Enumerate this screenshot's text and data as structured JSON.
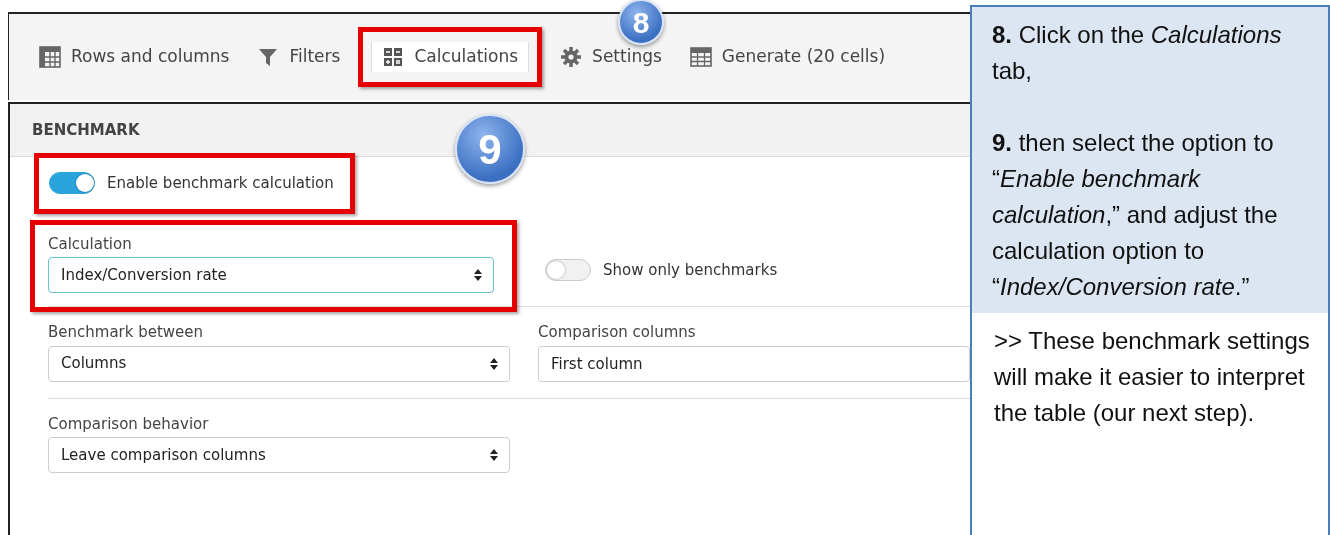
{
  "tabs": [
    {
      "label": "Rows and columns",
      "selected": false
    },
    {
      "label": "Filters",
      "selected": false
    },
    {
      "label": "Calculations",
      "selected": true
    },
    {
      "label": "Settings",
      "selected": false
    },
    {
      "label": "Generate (20 cells)",
      "selected": false
    }
  ],
  "highlighted_tab": {
    "selected": true
  },
  "step_badges": [
    {
      "number": "8"
    },
    {
      "number": "9"
    }
  ],
  "section": {
    "title": "BENCHMARK",
    "toggle": {
      "label": "Enable benchmark calculation",
      "on": true,
      "highlighted": true
    },
    "rows": [
      [
        {
          "kind": "select",
          "label": "Calculation",
          "value": "Index/Conversion rate",
          "highlighted": true,
          "focused": true
        },
        {
          "kind": "toggle",
          "label": "Show only benchmarks",
          "on": false
        }
      ],
      [
        {
          "kind": "select",
          "label": "Benchmark between",
          "value": "Columns",
          "highlighted": false,
          "focused": false
        },
        {
          "kind": "text",
          "label": "Comparison columns",
          "value": "First column"
        }
      ],
      [
        {
          "kind": "select",
          "label": "Comparison behavior",
          "value": "Leave comparison columns",
          "highlighted": false,
          "focused": false
        }
      ]
    ]
  },
  "instructions": {
    "steps": [
      "**8.** Click on the *Calculations* tab,",
      "**9.** then select the option to “*Enable benchmark calculation*,” and adjust the calculation option to “*Index/Conversion rate*.”"
    ],
    "note": ">> These benchmark settings will make it easier to interpret the table (our next step)."
  }
}
